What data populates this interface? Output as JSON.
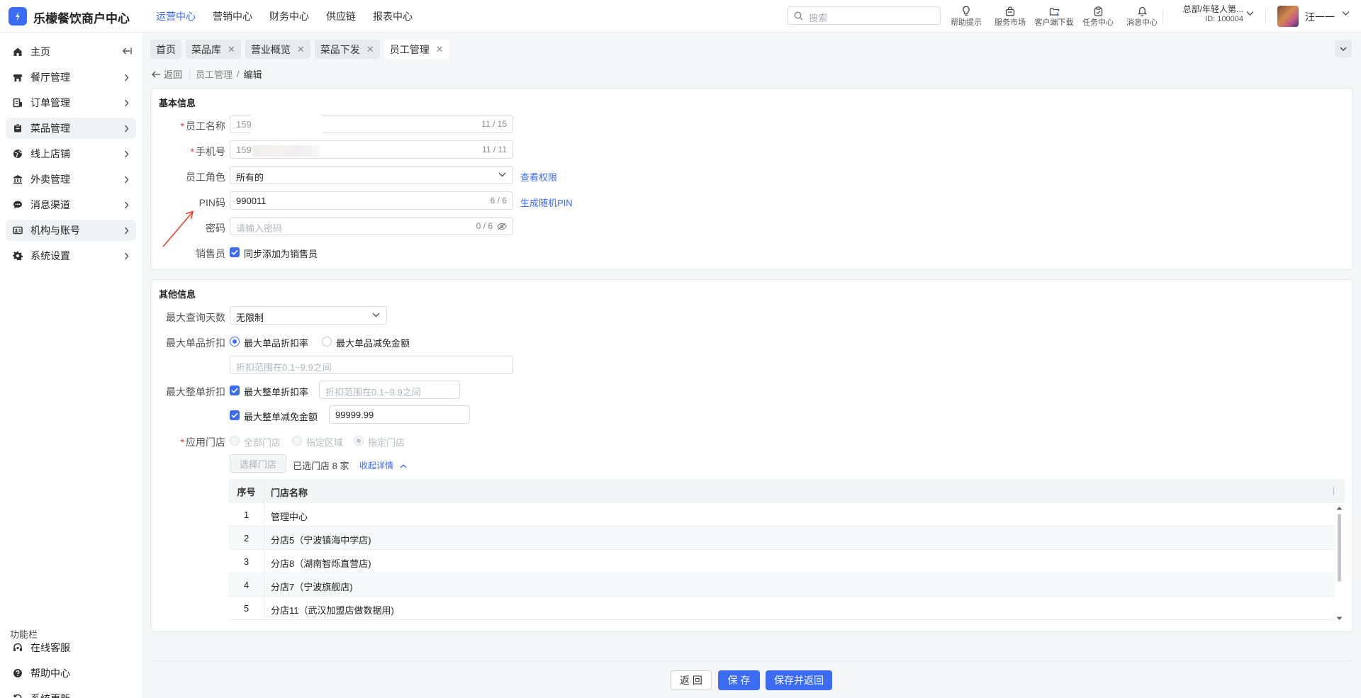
{
  "app": {
    "title": "乐檬餐饮商户中心"
  },
  "top_nav": [
    {
      "label": "运营中心",
      "active": true
    },
    {
      "label": "营销中心",
      "active": false
    },
    {
      "label": "财务中心",
      "active": false
    },
    {
      "label": "供应链",
      "active": false
    },
    {
      "label": "报表中心",
      "active": false
    }
  ],
  "search": {
    "placeholder": "搜索"
  },
  "tools": [
    {
      "label": "帮助提示",
      "icon": "lightbulb-icon"
    },
    {
      "label": "服务市场",
      "icon": "shopping-bag-icon"
    },
    {
      "label": "客户端下载",
      "icon": "download-folder-icon"
    },
    {
      "label": "任务中心",
      "icon": "clipboard-icon"
    },
    {
      "label": "消息中心",
      "icon": "bell-icon"
    }
  ],
  "org": {
    "name": "总部/年轻人第...",
    "id": "ID: 100004"
  },
  "user": {
    "name": "汪一一"
  },
  "sidebar": {
    "items": [
      {
        "label": "主页",
        "icon": "home-icon"
      },
      {
        "label": "餐厅管理",
        "icon": "store-icon"
      },
      {
        "label": "订单管理",
        "icon": "order-icon"
      },
      {
        "label": "菜品管理",
        "icon": "dish-icon"
      },
      {
        "label": "线上店铺",
        "icon": "globe-icon"
      },
      {
        "label": "外卖管理",
        "icon": "bank-icon"
      },
      {
        "label": "消息渠道",
        "icon": "chat-icon"
      },
      {
        "label": "机构与账号",
        "icon": "id-card-icon"
      },
      {
        "label": "系统设置",
        "icon": "gear-icon"
      }
    ],
    "func_title": "功能栏",
    "func_items": [
      {
        "label": "在线客服",
        "icon": "headset-icon"
      },
      {
        "label": "帮助中心",
        "icon": "help-circle-icon"
      },
      {
        "label": "系统更新",
        "icon": "refresh-icon"
      }
    ]
  },
  "tabs": [
    {
      "label": "首页",
      "closable": false
    },
    {
      "label": "菜品库",
      "closable": true
    },
    {
      "label": "营业概览",
      "closable": true
    },
    {
      "label": "菜品下发",
      "closable": true
    },
    {
      "label": "员工管理",
      "closable": true,
      "active": true
    }
  ],
  "breadcrumb": {
    "back": "返回",
    "parent": "员工管理",
    "separator": "/",
    "current": "编辑"
  },
  "basic": {
    "title": "基本信息",
    "name": {
      "label": "员工名称",
      "value": "159",
      "count": "11 / 15"
    },
    "phone": {
      "label": "手机号",
      "value": "159",
      "count": "11 / 11"
    },
    "role": {
      "label": "员工角色",
      "value": "所有的",
      "link": "查看权限"
    },
    "pin": {
      "label": "PIN码",
      "value": "990011",
      "count": "6 / 6",
      "link": "生成随机PIN"
    },
    "password": {
      "label": "密码",
      "placeholder": "请输入密码",
      "count": "0 / 6"
    },
    "sales": {
      "label": "销售员",
      "option": "同步添加为销售员",
      "checked": true
    }
  },
  "other": {
    "title": "其他信息",
    "max_days": {
      "label": "最大查询天数",
      "value": "无限制"
    },
    "item_discount": {
      "label": "最大单品折扣",
      "opt1": "最大单品折扣率",
      "opt2": "最大单品减免金额",
      "selected": "最大单品折扣率",
      "placeholder": "折扣范围在0.1~9.9之间"
    },
    "order_discount": {
      "label": "最大整单折扣",
      "rate_label": "最大整单折扣率",
      "rate_placeholder": "折扣范围在0.1~9.9之间",
      "amount_label": "最大整单减免金额",
      "amount_value": "99999.99"
    },
    "stores": {
      "label": "应用门店",
      "opt_all": "全部门店",
      "opt_region": "指定区域",
      "opt_store": "指定门店",
      "selected": "指定门店",
      "select_btn": "选择门店",
      "selected_text": "已选门店 8 家",
      "collapse_link": "收起详情"
    },
    "table": {
      "headers": [
        "序号",
        "门店名称"
      ],
      "rows": [
        [
          "1",
          "管理中心"
        ],
        [
          "2",
          "分店5（宁波镇海中学店)"
        ],
        [
          "3",
          "分店8（湖南智烁直营店)"
        ],
        [
          "4",
          "分店7（宁波旗舰店)"
        ],
        [
          "5",
          "分店11（武汉加盟店做数据用)"
        ]
      ]
    }
  },
  "footer": {
    "back": "返 回",
    "save": "保 存",
    "save_back": "保存并返回"
  },
  "colors": {
    "accent": "#3b6cf3",
    "required": "#e33333",
    "annotation_arrow": "#e8432e"
  }
}
